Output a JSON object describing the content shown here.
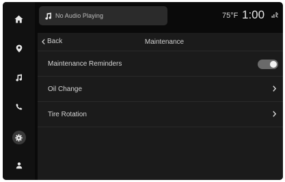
{
  "rail": {
    "items": [
      {
        "icon": "home-icon",
        "active": false
      },
      {
        "icon": "location-pin-icon",
        "active": false
      },
      {
        "icon": "music-note-icon",
        "active": false
      },
      {
        "icon": "phone-icon",
        "active": false
      },
      {
        "icon": "gear-icon",
        "active": true
      },
      {
        "icon": "user-icon",
        "active": false
      }
    ]
  },
  "status": {
    "audio": "No Audio Playing",
    "temperature": "75°F",
    "time": "1:00"
  },
  "panel": {
    "back_label": "Back",
    "title": "Maintenance",
    "rows": [
      {
        "label": "Maintenance Reminders",
        "control": "toggle",
        "on": true
      },
      {
        "label": "Oil Change",
        "control": "chevron-right"
      },
      {
        "label": "Tire Rotation",
        "control": "chevron-right"
      }
    ]
  },
  "colors": {
    "background": "#0a0a0a",
    "panel": "#1b1b1b",
    "text": "#d6d6d6",
    "toggle_on": "#6a6a6a"
  }
}
